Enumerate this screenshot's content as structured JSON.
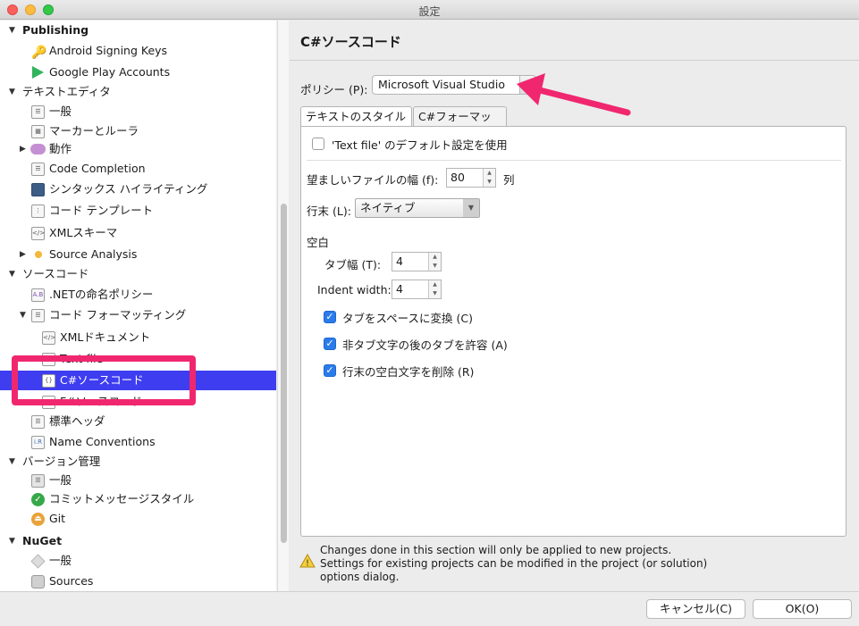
{
  "window": {
    "title": "設定"
  },
  "sidebar": {
    "items": [
      {
        "label": "Publishing",
        "bold": true,
        "disclosure": "▼",
        "icon": ""
      },
      {
        "label": "Android Signing Keys",
        "icon": "key-icon"
      },
      {
        "label": "Google Play Accounts",
        "icon": "play-store-icon"
      },
      {
        "label": "テキストエディタ",
        "disclosure": "▼"
      },
      {
        "label": "一般",
        "icon": "general-settings-icon"
      },
      {
        "label": "マーカーとルーラ",
        "icon": "markers-icon"
      },
      {
        "label": "動作",
        "disclosure": "▶",
        "icon": "speech-bubble-icon"
      },
      {
        "label": "Code Completion",
        "icon": "list-icon"
      },
      {
        "label": "シンタックス ハイライティング",
        "icon": "syntax-highlight-icon"
      },
      {
        "label": "コード テンプレート",
        "icon": "template-icon"
      },
      {
        "label": "XMLスキーマ",
        "icon": "xml-icon"
      },
      {
        "label": "Source Analysis",
        "disclosure": "▶",
        "icon": "dot-icon"
      },
      {
        "label": "ソースコード",
        "disclosure": "▼"
      },
      {
        "label": ".NETの命名ポリシー",
        "icon": "naming-icon"
      },
      {
        "label": "コード フォーマッティング",
        "disclosure": "▼",
        "icon": "format-icon"
      },
      {
        "label": "XMLドキュメント",
        "icon": "xml-doc-icon"
      },
      {
        "label": "Text file",
        "icon": "text-file-icon"
      },
      {
        "label": "C#ソースコード",
        "icon": "csharp-file-icon",
        "selected": true
      },
      {
        "label": "F#ソースコード",
        "icon": "file-icon"
      },
      {
        "label": "標準ヘッダ",
        "icon": "header-icon"
      },
      {
        "label": "Name Conventions",
        "icon": "name-conventions-icon"
      },
      {
        "label": "バージョン管理",
        "disclosure": "▼"
      },
      {
        "label": "一般",
        "icon": "vcs-general-icon"
      },
      {
        "label": "コミットメッセージスタイル",
        "icon": "commit-style-icon"
      },
      {
        "label": "Git",
        "icon": "git-icon"
      },
      {
        "label": "NuGet",
        "bold": true,
        "disclosure": "▼"
      },
      {
        "label": "一般",
        "icon": "nuget-general-icon"
      },
      {
        "label": "Sources",
        "icon": "sources-icon"
      }
    ]
  },
  "main": {
    "title": "C#ソースコード",
    "policy_label": "ポリシー (P):",
    "policy_value": "Microsoft Visual Studio",
    "tabs": [
      "テキストのスタイル",
      "C#フォーマット"
    ],
    "default_check_label": "'Text file' のデフォルト設定を使用",
    "width_label": "望ましいファイルの幅 (f):",
    "width_value": "80",
    "width_unit": "列",
    "eol_label": "行末 (L):",
    "eol_value": "ネイティブ",
    "whitespace_label": "空白",
    "tab_width_label": "タブ幅 (T):",
    "tab_width_value": "4",
    "indent_width_label": "Indent width:",
    "indent_width_value": "4",
    "check1": "タブをスペースに変換 (C)",
    "check2": "非タブ文字の後のタブを許容 (A)",
    "check3": "行末の空白文字を削除 (R)",
    "warning": "Changes done in this section will only be applied to new projects. Settings for existing projects can be modified in the project (or solution) options dialog."
  },
  "footer": {
    "cancel": "キャンセル(C)",
    "ok": "OK(O)"
  },
  "colors": {
    "selection": "#3e3df0",
    "highlight": "#f0276f",
    "check": "#2b7bea"
  }
}
